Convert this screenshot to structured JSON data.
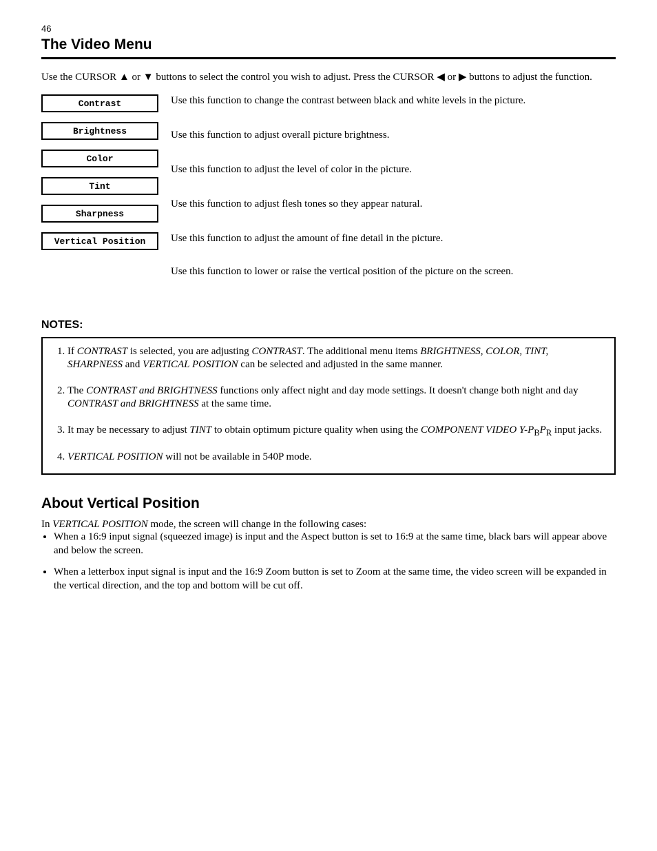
{
  "page_number": "46",
  "chapter_title": "The Video Menu",
  "intro_1": "Use the CURSOR ",
  "intro_2": " or ",
  "intro_3": " buttons to select the control you wish to adjust. Press the CURSOR ",
  "intro_4": " or ",
  "intro_5": " buttons to adjust the function.",
  "menu": {
    "items": [
      {
        "label": "Contrast",
        "desc": "Use this function to change the contrast between black and white levels in the picture."
      },
      {
        "label": "Brightness",
        "desc": "Use this function to adjust overall picture brightness."
      },
      {
        "label": "Color",
        "desc": "Use this function to adjust the level of color in the picture."
      },
      {
        "label": "Tint",
        "desc": "Use this function to adjust flesh tones so they appear natural."
      },
      {
        "label": "Sharpness",
        "desc": "Use this function to adjust the amount of fine detail in the picture."
      },
      {
        "label": "Vertical Position",
        "desc": "Use this function to lower or raise the vertical position of the picture on the screen."
      }
    ]
  },
  "notes_title": "NOTES:",
  "notes": [
    {
      "t1": "If ",
      "em": "CONTRAST",
      "t2": " is selected, you are adjusting ",
      "em2": "CONTRAST",
      "t3": ". The additional menu items ",
      "em3": "BRIGHTNESS, COLOR, TINT, SHARPNESS",
      "t4": " and ",
      "em4": "VERTICAL POSITION",
      "t5": " can be selected and adjusted in the same manner."
    },
    {
      "t1": "The ",
      "em": "CONTRAST and BRIGHTNESS ",
      "t2": "functions only affect night and day mode settings. It doesn't change both night and day ",
      "em2": "CONTRAST and BRIGHTNESS ",
      "t3": "at the same time."
    },
    {
      "t1": "It may be necessary to adjust ",
      "em": "TINT",
      "t2": " to obtain optimum picture quality when using the ",
      "em2": "COMPONENT VIDEO Y-P",
      "sub1": "B",
      "em3": "P",
      "sub2": "R",
      "t3": " input jacks."
    },
    {
      "t1": "",
      "em": "VERTICAL POSITION",
      "t2": " will not be available in 540P mode."
    }
  ],
  "about_title": "About Vertical Position",
  "about_text_1": "In ",
  "about_em_1": "VERTICAL POSITION",
  "about_text_2": " mode, the screen will change in the following cases:",
  "about_bullets": [
    "When a 16:9 input signal (squeezed image) is input and the Aspect button is set to 16:9 at the same time, black bars will appear above and below the screen.",
    "When a letterbox input signal is input and the 16:9 Zoom button is set to Zoom at the same time, the video screen will be expanded in the vertical direction, and the top and bottom will be cut off."
  ]
}
